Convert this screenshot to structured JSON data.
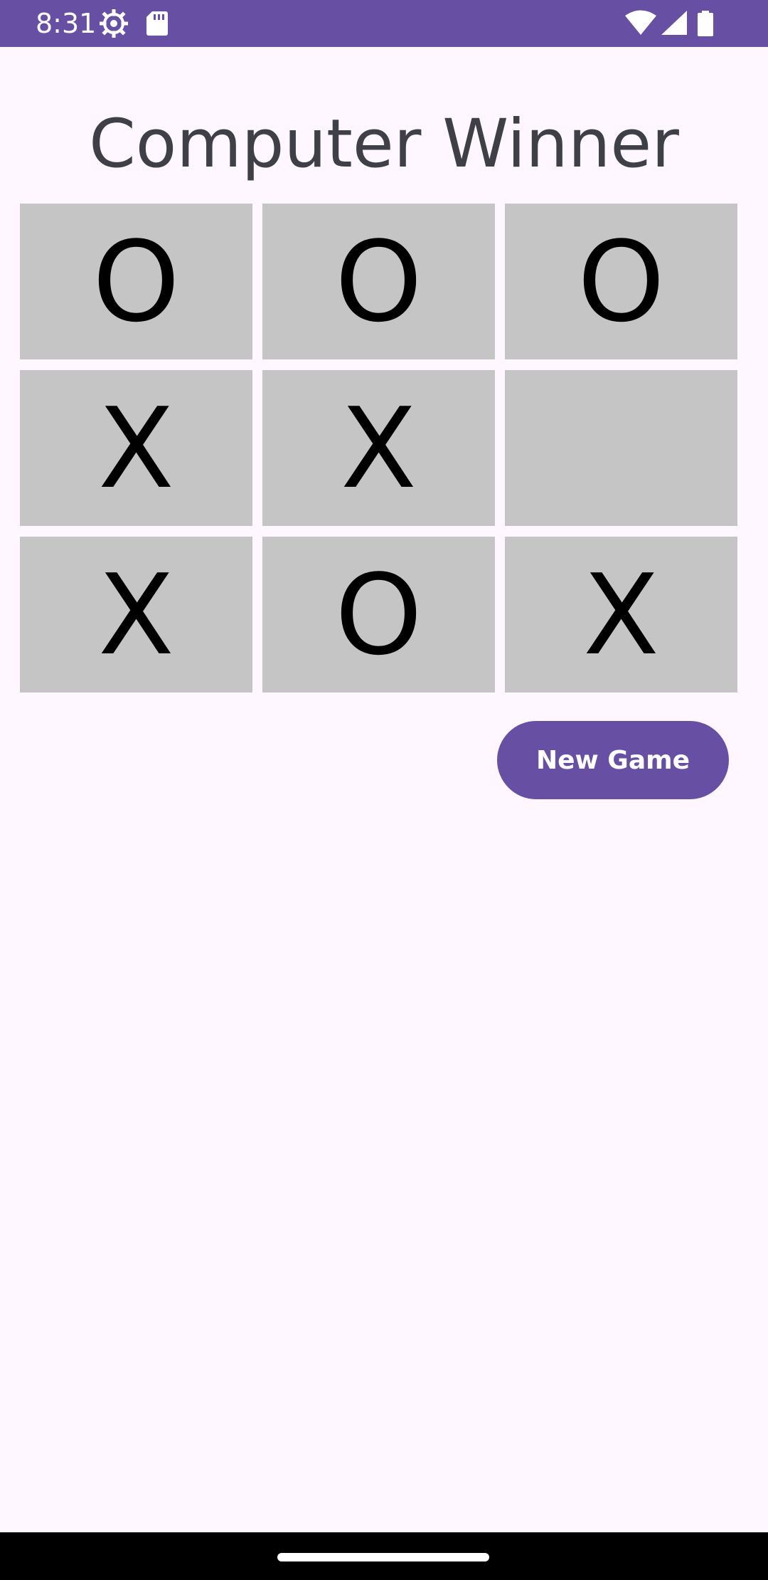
{
  "status_bar": {
    "time": "8:31",
    "icons": [
      "settings-gear-icon",
      "sd-card-icon",
      "wifi-icon",
      "signal-icon",
      "battery-icon"
    ]
  },
  "game": {
    "status_title": "Computer Winner",
    "board": [
      [
        "O",
        "O",
        "O"
      ],
      [
        "X",
        "X",
        ""
      ],
      [
        "X",
        "O",
        "X"
      ]
    ]
  },
  "actions": {
    "new_game_label": "New Game"
  },
  "colors": {
    "primary": "#6750A4",
    "background": "#FEF7FF",
    "cell": "#C6C5C6",
    "title_text": "#3F3F47"
  }
}
